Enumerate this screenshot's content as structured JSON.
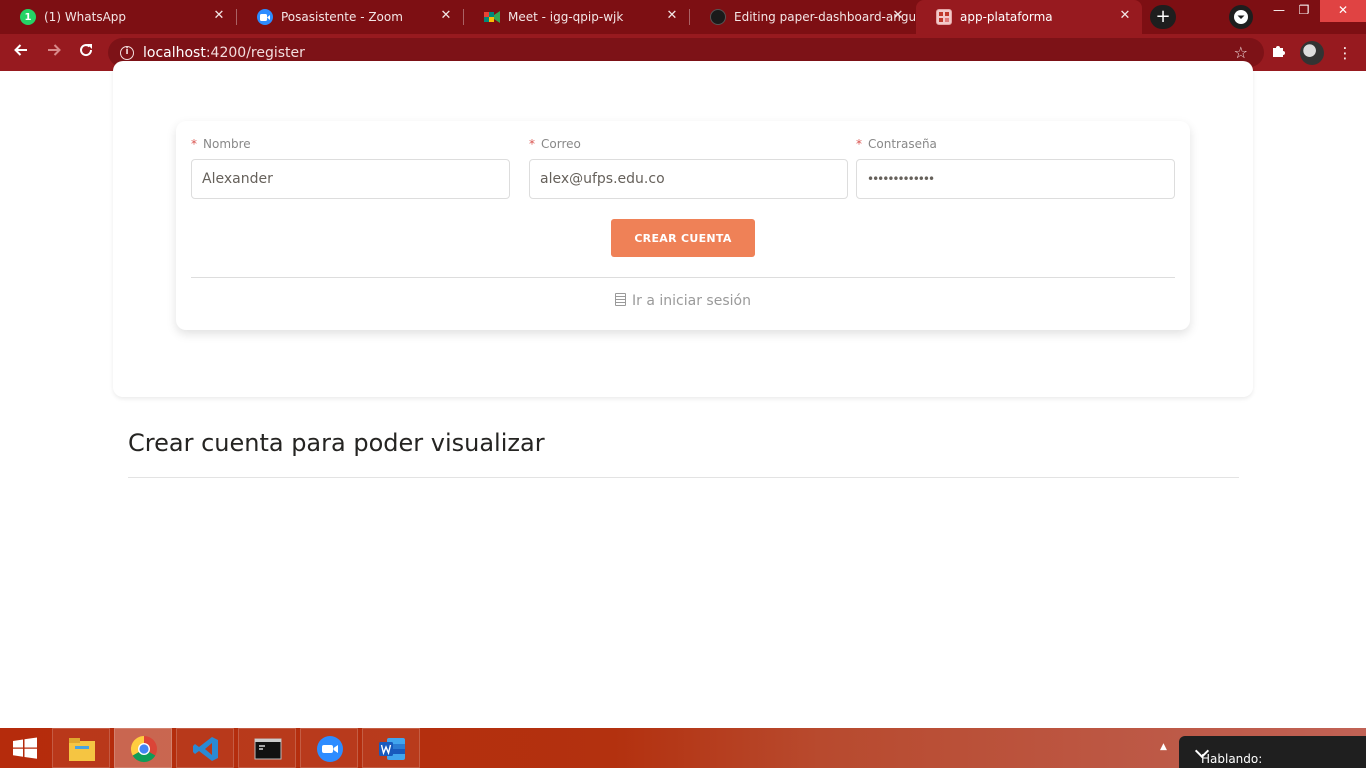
{
  "browser": {
    "tabs": [
      {
        "title": "(1) WhatsApp",
        "icon": "whatsapp-icon",
        "color": "#25d366",
        "badge": "1"
      },
      {
        "title": "Posasistente - Zoom",
        "icon": "zoom-icon",
        "color": "#2d8cff"
      },
      {
        "title": "Meet - igg-qpip-wjk",
        "icon": "google-meet-icon",
        "color": "#00897b"
      },
      {
        "title": "Editing paper-dashboard-angu",
        "icon": "github-icon",
        "color": "#222222"
      },
      {
        "title": "app-plataforma",
        "icon": "app-icon",
        "color": "#e3a5a5"
      }
    ],
    "url_host": "localhost",
    "url_rest": ":4200/register"
  },
  "form": {
    "name_label": "Nombre",
    "name_value": "Alexander",
    "email_label": "Correo",
    "email_value": "alex@ufps.edu.co",
    "password_label": "Contraseña",
    "password_value": "•••••••••••••",
    "required_mark": "*",
    "submit_label": "CREAR CUENTA",
    "login_link": "Ir a iniciar sesión"
  },
  "section": {
    "title": "Crear cuenta para poder visualizar"
  },
  "taskbar": {
    "apps": [
      "file-explorer-icon",
      "chrome-icon",
      "vscode-icon",
      "terminal-icon",
      "zoom-icon",
      "word-icon"
    ],
    "notification_text": "Hablando:"
  },
  "colors": {
    "accent": "#ef8157",
    "browser_frame": "#971a1f",
    "tabstrip": "#7d0f13"
  }
}
